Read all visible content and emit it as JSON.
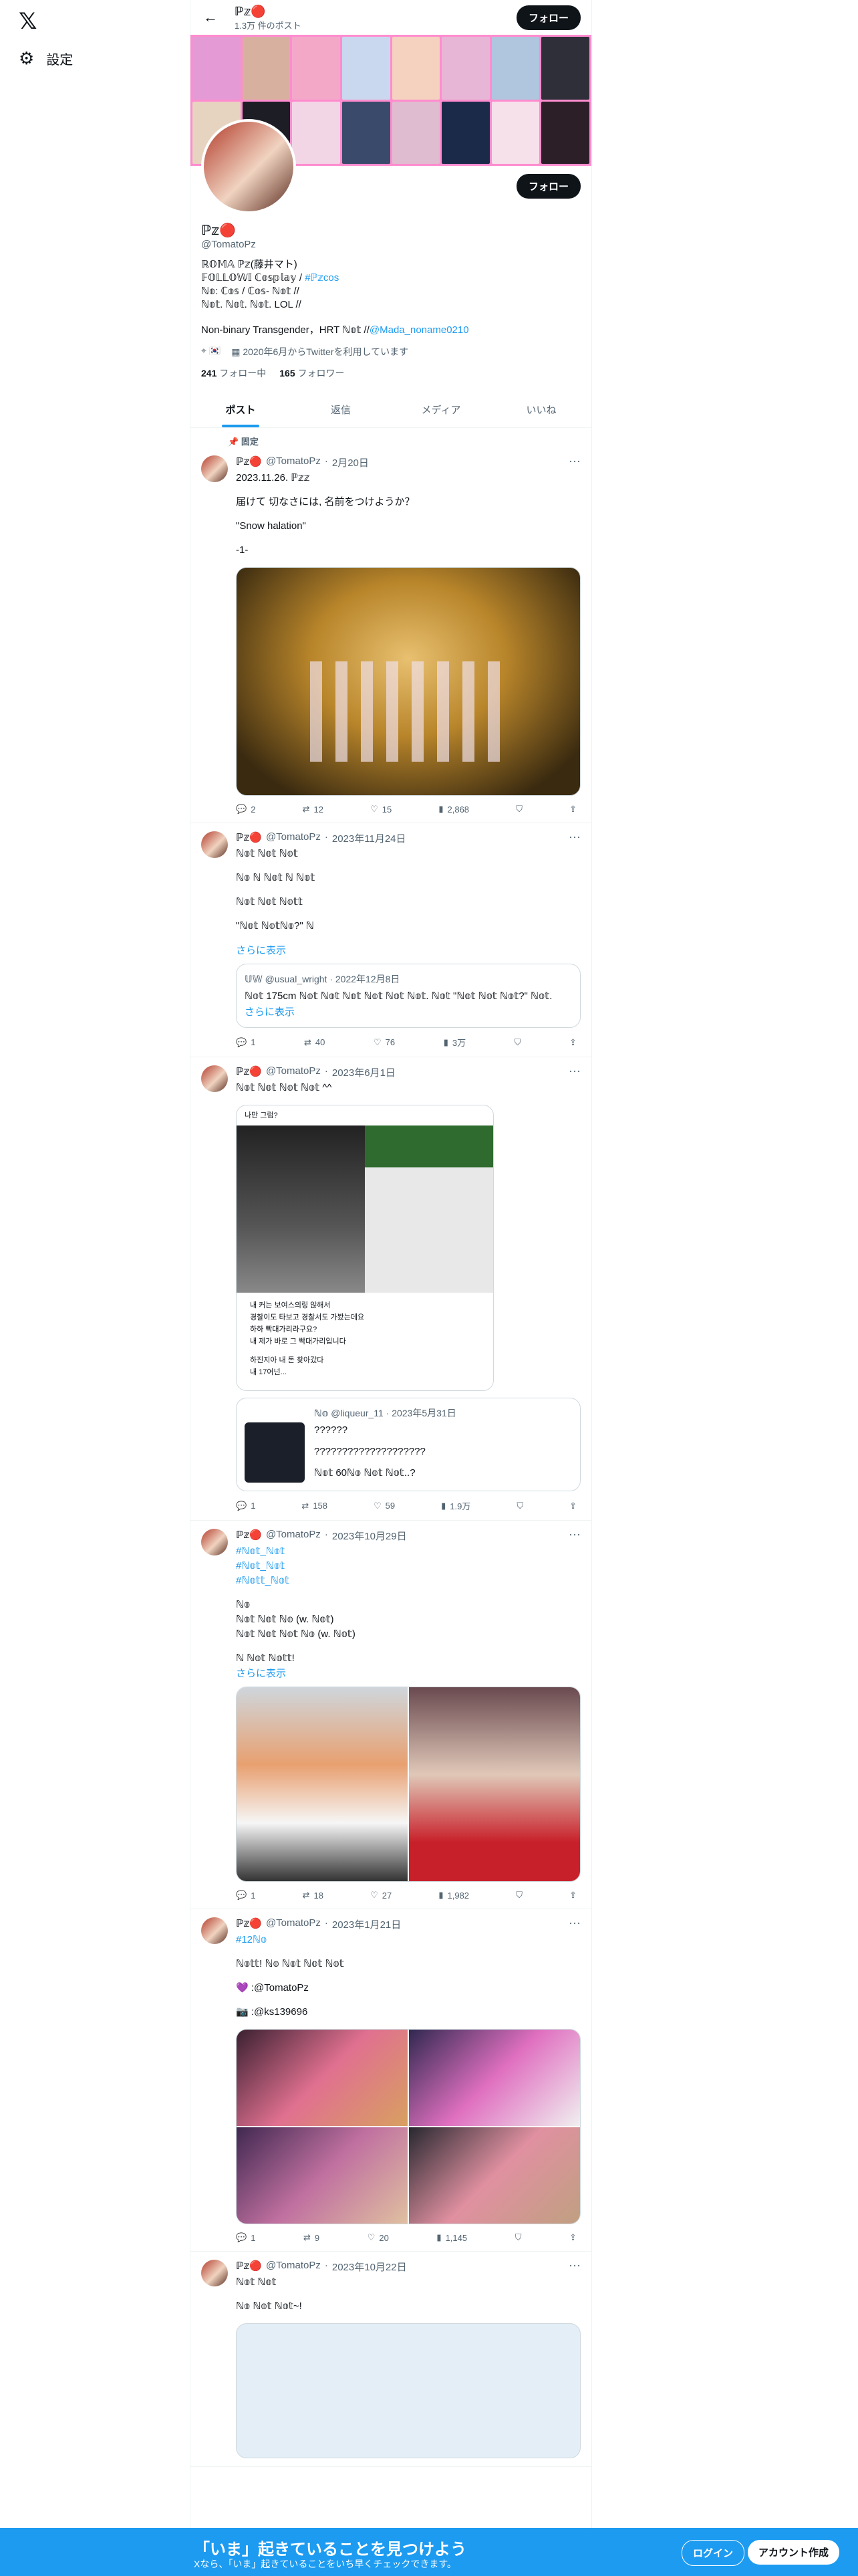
{
  "nav": {
    "logo": "𝕏",
    "settings_label": "設定"
  },
  "header": {
    "name": "ℙ𝕫🔴",
    "post_count": "1.3万 件のポスト",
    "follow_label": "フォロー"
  },
  "profile": {
    "name": "ℙ𝕫🔴",
    "handle": "@TomatoPz",
    "bio_line1": "ℝ𝕆𝕄𝔸 ℙ𝕫(藤井マト)",
    "bio_line2": "𝔽𝕆𝕃𝕃𝕆𝕎𝕀 ℂ𝕠𝕤𝕡𝕝𝕒𝕪 / ",
    "bio_link1": "#ℙ𝕫cos",
    "bio_line3": "ℕ𝕠: ℂ𝕠𝕤 / ℂ𝕠𝕤- ℕ𝕠𝕥 //",
    "bio_line4": "ℕ𝕠𝕥. ℕ𝕠𝕥. ℕ𝕠𝕥. LOL //",
    "bio_line5": "Non-binary Transgender，HRT ℕ𝕠𝕥 //",
    "bio_link2": "@Mada_noname0210",
    "joined": "2020年6月からTwitterを利用しています",
    "location": "🇰🇷",
    "following_count": "241",
    "following_label": "フォロー中",
    "followers_count": "165",
    "followers_label": "フォロワー"
  },
  "tabs": [
    "ポスト",
    "返信",
    "メディア",
    "いいね"
  ],
  "posts": [
    {
      "pinned": "固定",
      "name": "ℙ𝕫🔴",
      "handle": "@TomatoPz",
      "date": "2月20日",
      "lines": [
        "2023.11.26. ℙ𝕫𝕫",
        "届けて 切なさには, 名前をつけようか？",
        "\"Snow halation\"",
        "-1-"
      ],
      "stats": {
        "reply": "2",
        "repost": "12",
        "like": "15",
        "views": "2,868"
      }
    },
    {
      "name": "ℙ𝕫🔴",
      "handle": "@TomatoPz",
      "date": "2023年11月24日",
      "lines": [
        "ℕ𝕠𝕥 ℕ𝕠𝕥 ℕ𝕠𝕥",
        "ℕ𝕠 ℕ ℕ𝕠𝕥 ℕ ℕ𝕠𝕥",
        "ℕ𝕠𝕥 ℕ𝕠𝕥 ℕ𝕠𝕥𝕥",
        "\"ℕ𝕠𝕥 ℕ𝕠𝕥ℕ𝕠?\" ℕ"
      ],
      "show_more": "さらに表示",
      "quote": {
        "name": "𝕌𝕎",
        "handle": "@usual_wright",
        "date": "2022年12月8日",
        "text": "ℕ𝕠𝕥 175cm ℕ𝕠𝕥 ℕ𝕠𝕥 ℕ𝕠𝕥 ℕ𝕠𝕥 ℕ𝕠𝕥 ℕ𝕠𝕥. ℕ𝕠𝕥 \"ℕ𝕠𝕥 ℕ𝕠𝕥 ℕ𝕠𝕥?\" ℕ𝕠𝕥.",
        "show_more": "さらに表示"
      },
      "stats": {
        "reply": "1",
        "repost": "40",
        "like": "76",
        "views": "3万"
      }
    },
    {
      "name": "ℙ𝕫🔴",
      "handle": "@TomatoPz",
      "date": "2023年6月1日",
      "lines": [
        "ℕ𝕠𝕥 ℕ𝕠𝕥 ℕ𝕠𝕥 ℕ𝕠𝕥 ^^"
      ],
      "card_title": "나만 그럼?",
      "card_lines": [
        "내 커는 보여스의링 않해서",
        "경찰이도 타보고 경찰서도 가봤는데요",
        "하하 빡대가리라구요?",
        "내 제가 바로 그 빡대가리입니다",
        "하진지아 내 돈 찾아갔다",
        "내 17어넌..."
      ],
      "quote": {
        "name": "ℕ𝕠",
        "handle": "@liqueur_11",
        "date": "2023年5月31日",
        "line1": "??????",
        "line2": "????????????????????",
        "line3": "ℕ𝕠𝕥 60ℕ𝕠 ℕ𝕠𝕥 ℕ𝕠𝕥..?"
      },
      "stats": {
        "reply": "1",
        "repost": "158",
        "like": "59",
        "views": "1.9万"
      }
    },
    {
      "name": "ℙ𝕫🔴",
      "handle": "@TomatoPz",
      "date": "2023年10月29日",
      "tags": [
        "#ℕ𝕠𝕥_ℕ𝕠𝕥",
        "#ℕ𝕠𝕥_ℕ𝕠𝕥",
        "#ℕ𝕠𝕥𝕥_ℕ𝕠𝕥"
      ],
      "lines": [
        "ℕ𝕠",
        "ℕ𝕠𝕥 ℕ𝕠𝕥 ℕ𝕠 (w. ℕ𝕠𝕥)",
        "ℕ𝕠𝕥 ℕ𝕠𝕥 ℕ𝕠𝕥 ℕ𝕠 (w. ℕ𝕠𝕥)",
        "ℕ ℕ𝕠𝕥 ℕ𝕠𝕥𝕥!"
      ],
      "show_more": "さらに表示",
      "stats": {
        "reply": "1",
        "repost": "18",
        "like": "27",
        "views": "1,982"
      }
    },
    {
      "name": "ℙ𝕫🔴",
      "handle": "@TomatoPz",
      "date": "2023年1月21日",
      "tags": [
        "#12ℕ𝕠"
      ],
      "lines": [
        "ℕ𝕠𝕥𝕥! ℕ𝕠 ℕ𝕠𝕥 ℕ𝕠𝕥 ℕ𝕠𝕥",
        "💜 :@TomatoPz",
        "📷 :@ks139696"
      ],
      "stats": {
        "reply": "1",
        "repost": "9",
        "like": "20",
        "views": "1,145"
      }
    },
    {
      "name": "ℙ𝕫🔴",
      "handle": "@TomatoPz",
      "date": "2023年10月22日",
      "lines": [
        "ℕ𝕠𝕥 ℕ𝕠𝕥",
        "ℕ𝕠 ℕ𝕠𝕥 ℕ𝕠𝕥~!"
      ]
    }
  ],
  "bottom_bar": {
    "title": "「いま」起きていることを見つけよう",
    "subtitle": "Xなら、「いま」起きていることをいち早くチェックできます。",
    "login": "ログイン",
    "signup": "アカウント作成"
  },
  "colors": {
    "accent": "#1d9bf0",
    "banner": "#ff8ccf"
  }
}
